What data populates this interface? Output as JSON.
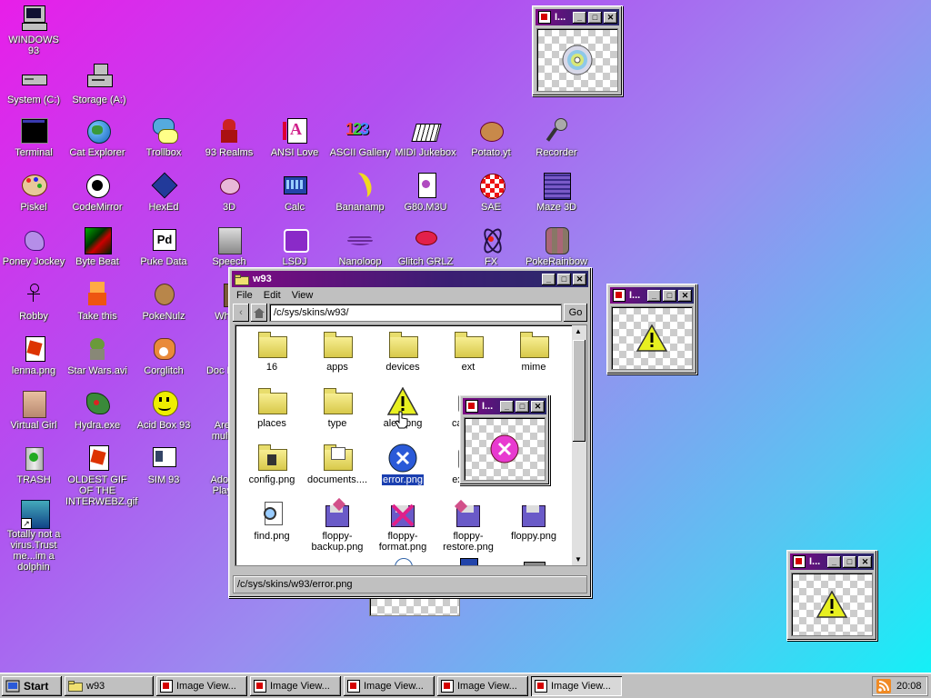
{
  "desktop_icons": [
    {
      "label": "WINDOWS 93",
      "icon": "computer-icon"
    },
    {
      "label": "System (C:)",
      "icon": "drive-icon"
    },
    {
      "label": "Storage (A:)",
      "icon": "floppy-drive-icon"
    },
    {
      "label": "Terminal",
      "icon": "terminal-icon"
    },
    {
      "label": "Cat Explorer",
      "icon": "globe-cat-icon"
    },
    {
      "label": "Trollbox",
      "icon": "chat-icon"
    },
    {
      "label": "93 Realms",
      "icon": "knight-icon"
    },
    {
      "label": "ANSI Love",
      "icon": "pencil-a-icon"
    },
    {
      "label": "ASCII Gallery",
      "icon": "123-icon"
    },
    {
      "label": "MIDI Jukebox",
      "icon": "piano-icon"
    },
    {
      "label": "Potato.yt",
      "icon": "potato-icon"
    },
    {
      "label": "Recorder",
      "icon": "microphone-icon"
    },
    {
      "label": "Piskel",
      "icon": "palette-icon"
    },
    {
      "label": "CodeMirror",
      "icon": "code-icon"
    },
    {
      "label": "HexEd",
      "icon": "cube-icon"
    },
    {
      "label": "3D",
      "icon": "teapot-icon"
    },
    {
      "label": "Calc",
      "icon": "calculator-icon"
    },
    {
      "label": "Bananamp",
      "icon": "banana-icon"
    },
    {
      "label": "G80.M3U",
      "icon": "playlist-icon"
    },
    {
      "label": "SAE",
      "icon": "ball-icon"
    },
    {
      "label": "Maze 3D",
      "icon": "maze-icon"
    },
    {
      "label": "Poney Jockey",
      "icon": "pony-icon"
    },
    {
      "label": "Byte Beat",
      "icon": "bytebeat-icon"
    },
    {
      "label": "Puke Data",
      "icon": "pd-icon"
    },
    {
      "label": "Speech",
      "icon": "face-icon"
    },
    {
      "label": "LSDJ",
      "icon": "lsdj-icon"
    },
    {
      "label": "Nanoloop",
      "icon": "wave-icon"
    },
    {
      "label": "Glitch GRLZ",
      "icon": "lips-icon"
    },
    {
      "label": "FX",
      "icon": "atom-icon"
    },
    {
      "label": "PokeRainbow",
      "icon": "poke-icon"
    },
    {
      "label": "Robby",
      "icon": "stickman-icon"
    },
    {
      "label": "Take this",
      "icon": "character-icon"
    },
    {
      "label": "PokeNulz",
      "icon": "ball-doll-icon"
    },
    {
      "label": "Wha...",
      "icon": "box-icon"
    },
    {
      "label": "lenna.png",
      "icon": "image-file-icon"
    },
    {
      "label": "Star Wars.avi",
      "icon": "yoda-icon"
    },
    {
      "label": "Corglitch",
      "icon": "corgi-icon"
    },
    {
      "label": "Doc Mar...",
      "icon": "doc-icon"
    },
    {
      "label": "Virtual Girl",
      "icon": "girl-icon"
    },
    {
      "label": "Hydra.exe",
      "icon": "dragon-icon"
    },
    {
      "label": "Acid Box 93",
      "icon": "smiley-icon"
    },
    {
      "label": "Aren... multip...",
      "icon": "arena-icon"
    },
    {
      "label": "TRASH",
      "icon": "trash-icon"
    },
    {
      "label": "OLDEST GIF OF THE INTERWEBZ.gif",
      "icon": "image-file-icon"
    },
    {
      "label": "SIM 93",
      "icon": "sim-icon"
    },
    {
      "label": "Adobe... Playe...",
      "icon": "adobe-icon"
    },
    {
      "label": "Totally not a virus.Trust me...im a dolphin",
      "icon": "dolphin-icon"
    }
  ],
  "explorer": {
    "title": "w93",
    "menu": [
      "File",
      "Edit",
      "View"
    ],
    "back": "‹",
    "address": "/c/sys/skins/w93/",
    "go": "Go",
    "files": [
      {
        "label": "16",
        "type": "folder"
      },
      {
        "label": "apps",
        "type": "folder"
      },
      {
        "label": "devices",
        "type": "folder"
      },
      {
        "label": "ext",
        "type": "folder"
      },
      {
        "label": "mime",
        "type": "folder"
      },
      {
        "label": "places",
        "type": "folder"
      },
      {
        "label": "type",
        "type": "folder"
      },
      {
        "label": "alert.png",
        "type": "alert"
      },
      {
        "label": "came...",
        "type": "camera"
      },
      {
        "label": "config.png",
        "type": "config"
      },
      {
        "label": "documents....",
        "type": "documents"
      },
      {
        "label": "error.png",
        "type": "error",
        "selected": true
      },
      {
        "label": "explo...",
        "type": "explorer"
      },
      {
        "label": "find.png",
        "type": "find"
      },
      {
        "label": "floppy-backup.png",
        "type": "floppy"
      },
      {
        "label": "floppy-format.png",
        "type": "floppy"
      },
      {
        "label": "floppy-restore.png",
        "type": "floppy"
      },
      {
        "label": "floppy.png",
        "type": "floppy"
      }
    ],
    "status": "/c/sys/skins/w93/error.png"
  },
  "image_viewers": [
    {
      "title": "I...",
      "content": "cd-icon"
    },
    {
      "title": "I...",
      "content": "warning-icon"
    },
    {
      "title": "I...",
      "content": "error-icon"
    },
    {
      "title": "I...",
      "content": "warning-icon"
    }
  ],
  "taskbar": {
    "start": "Start",
    "tasks": [
      {
        "label": "w93",
        "icon": "folder-icon"
      },
      {
        "label": "Image View...",
        "icon": "image-icon"
      },
      {
        "label": "Image View...",
        "icon": "image-icon"
      },
      {
        "label": "Image View...",
        "icon": "image-icon"
      },
      {
        "label": "Image View...",
        "icon": "image-icon"
      },
      {
        "label": "Image View...",
        "icon": "image-icon"
      }
    ],
    "clock": "20:08"
  }
}
